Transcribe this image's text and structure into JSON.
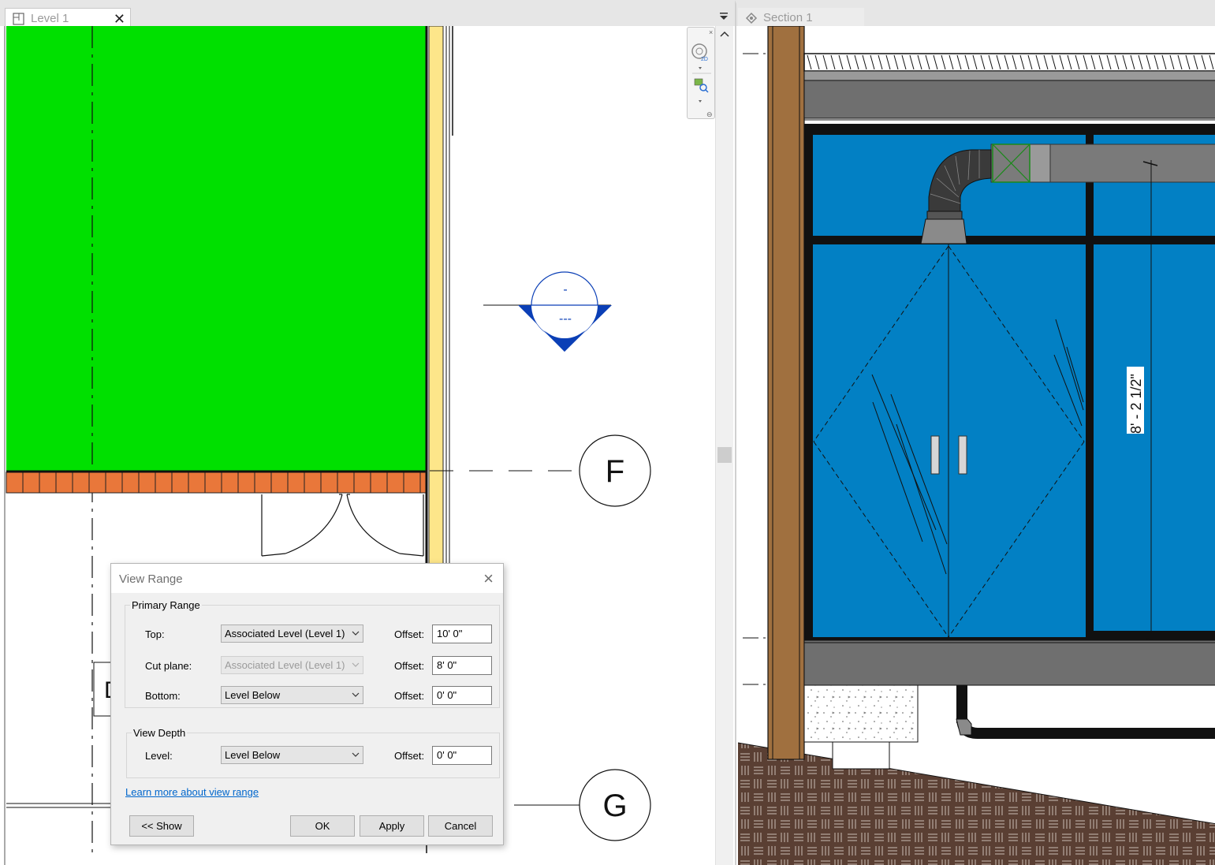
{
  "tabs": {
    "left": {
      "title": "Level 1",
      "close": "✕"
    },
    "right": {
      "title": "Section 1"
    }
  },
  "plan_view": {
    "grid_f": "F",
    "grid_g": "G",
    "tag_top": "-",
    "tag_bottom": "---",
    "room_tag_partial": "D",
    "colors": {
      "room_fill": "#00e000",
      "brick": "#e9773a",
      "wall": "#fde68a"
    }
  },
  "section_view": {
    "dimension": "8' - 2 1/2\"",
    "colors": {
      "glass": "#0280c4",
      "soil": "#5a3f33",
      "wood_column": "#a0703f",
      "duct": "#6f6f6f"
    }
  },
  "dialog": {
    "title": "View Range",
    "close": "×",
    "primary_range": {
      "label": "Primary Range",
      "top": {
        "label": "Top:",
        "value": "Associated Level (Level 1)",
        "offset_label": "Offset:",
        "offset": "10'  0\""
      },
      "cut_plane": {
        "label": "Cut plane:",
        "value": "Associated Level (Level 1)",
        "offset_label": "Offset:",
        "offset": "8'  0\""
      },
      "bottom": {
        "label": "Bottom:",
        "value": "Level Below",
        "offset_label": "Offset:",
        "offset": "0'  0\""
      }
    },
    "view_depth": {
      "label": "View Depth",
      "level": {
        "label": "Level:",
        "value": "Level Below",
        "offset_label": "Offset:",
        "offset": "0'  0\""
      }
    },
    "learn_more": "Learn more about view range",
    "buttons": {
      "show": "<< Show",
      "ok": "OK",
      "apply": "Apply",
      "cancel": "Cancel"
    }
  }
}
